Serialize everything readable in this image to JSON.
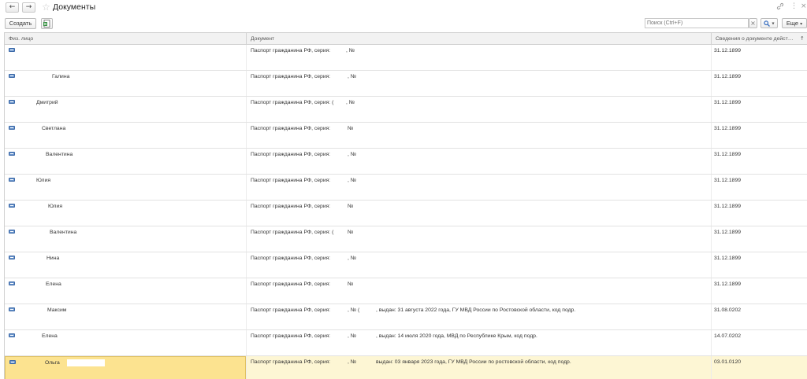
{
  "window": {
    "title": "Документы",
    "back_glyph": "←",
    "forward_glyph": "→",
    "favorite_glyph": "☆",
    "link_icon": "link-icon",
    "more_glyph": "⋮",
    "close_glyph": "×"
  },
  "toolbar": {
    "create_label": "Создать",
    "search_placeholder": "Поиск (Ctrl+F)",
    "clear_glyph": "×",
    "search_glyph": "🔍",
    "more_label": "Еще"
  },
  "table": {
    "headers": {
      "person": "Физ. лицо",
      "document": "Документ",
      "info": "Сведения о документе дейст…",
      "sort_glyph": "↑"
    },
    "rows": [
      {
        "name": "",
        "doc_prefix": "Паспорт гражданина РФ, серия:",
        "doc_no": ", №",
        "issued": "",
        "date": "31.12.1899"
      },
      {
        "name": "Галина",
        "doc_prefix": "Паспорт гражданина РФ, серия:",
        "doc_no": ", №",
        "issued": "",
        "date": "31.12.1899"
      },
      {
        "name": "Дмитрий",
        "doc_prefix": "Паспорт гражданина РФ, серия: (",
        "doc_no": ", №",
        "issued": "",
        "date": "31.12.1899"
      },
      {
        "name": "Светлана",
        "doc_prefix": "Паспорт гражданина РФ, серия:",
        "doc_no": "№",
        "issued": "",
        "date": "31.12.1899"
      },
      {
        "name": "Валентина",
        "doc_prefix": "Паспорт гражданина РФ, серия:",
        "doc_no": ", №",
        "issued": "",
        "date": "31.12.1899"
      },
      {
        "name": "Юлия",
        "doc_prefix": "Паспорт гражданина РФ, серия:",
        "doc_no": ", №",
        "issued": "",
        "date": "31.12.1899"
      },
      {
        "name": "Юлия",
        "doc_prefix": "Паспорт гражданина РФ, серия:",
        "doc_no": "№",
        "issued": "",
        "date": "31.12.1899"
      },
      {
        "name": "Валентина",
        "doc_prefix": "Паспорт гражданина РФ, серия: (",
        "doc_no": "№",
        "issued": "",
        "date": "31.12.1899"
      },
      {
        "name": "Нина",
        "doc_prefix": "Паспорт гражданина РФ, серия:",
        "doc_no": ", №",
        "issued": "",
        "date": "31.12.1899"
      },
      {
        "name": "Елена",
        "doc_prefix": "Паспорт гражданина РФ, серия:",
        "doc_no": "№",
        "issued": "",
        "date": "31.12.1899"
      },
      {
        "name": "Максим",
        "doc_prefix": "Паспорт гражданина РФ, серия:",
        "doc_no": ", № (",
        "issued": ", выдан: 31 августа 2022 года, ГУ МВД России по Ростовской области, код подр.",
        "date": "31.08.0202"
      },
      {
        "name": "Елена",
        "doc_prefix": "Паспорт гражданина РФ, серия:",
        "doc_no": ", №",
        "issued": ", выдан: 14 июля 2020 года, МВД по Республике Крым, код подр.",
        "date": "14.07.0202"
      },
      {
        "name": "Ольга",
        "doc_prefix": "Паспорт гражданина РФ, серия:",
        "doc_no": ", №",
        "issued": "выдан: 03 января 2023 года, ГУ МВД России по ростовской области, код подр.",
        "date": "03.01.0120",
        "selected": true
      }
    ]
  }
}
